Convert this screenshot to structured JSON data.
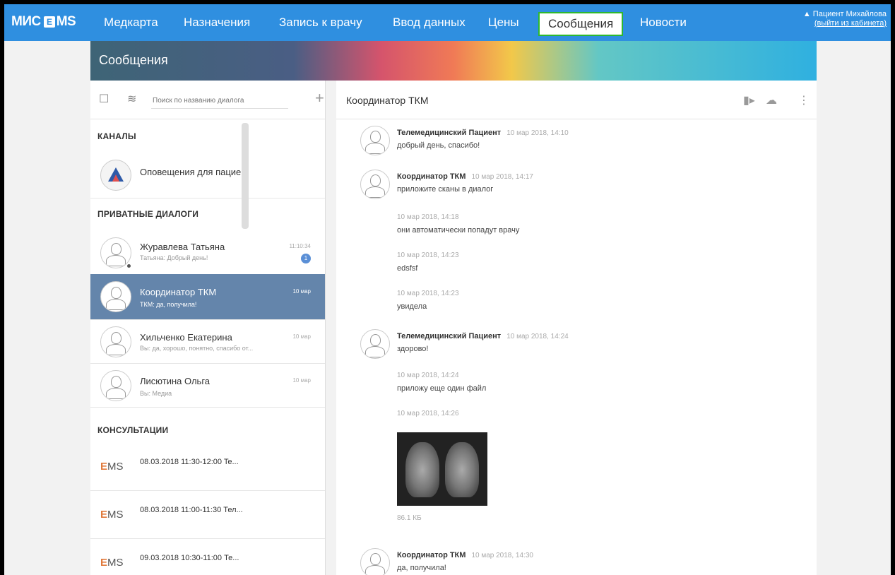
{
  "nav": {
    "logo_text": "МИС",
    "logo_badge": "E",
    "logo_suffix": "MS",
    "items": [
      {
        "label": "Медкарта"
      },
      {
        "label": "Назначения"
      },
      {
        "label": "Запись к врачу"
      },
      {
        "label": "Ввод данных"
      },
      {
        "label": "Цены"
      },
      {
        "label": "Сообщения"
      },
      {
        "label": "Новости"
      }
    ],
    "user_name": "Пациент Михайлова",
    "logout": "(выйти из кабинета)"
  },
  "banner": {
    "title": "Сообщения"
  },
  "left": {
    "search_placeholder": "Поиск по названию диалога",
    "sections": {
      "channels": "КАНАЛЫ",
      "private": "ПРИВАТНЫЕ ДИАЛОГИ",
      "consultations": "КОНСУЛЬТАЦИИ"
    },
    "channels": [
      {
        "name": "Оповещения для пацие..."
      }
    ],
    "private": [
      {
        "name": "Журавлева Татьяна",
        "sub": "Татьяна: Добрый день!",
        "date": "11:10:34",
        "badge": "1"
      },
      {
        "name": "Координатор ТКМ",
        "sub": "ТКМ: да, получила!",
        "date": "10 мар"
      },
      {
        "name": "Хильченко Екатерина",
        "sub": "Вы: да, хорошо, понятно, спасибо от...",
        "date": "10 мар"
      },
      {
        "name": "Лисютина Ольга",
        "sub": "Вы: Медиа",
        "date": "10 мар"
      }
    ],
    "consultations": [
      {
        "name": "08.03.2018 11:30-12:00 Te..."
      },
      {
        "name": "08.03.2018 11:00-11:30 Тел..."
      },
      {
        "name": "09.03.2018 10:30-11:00 Те..."
      }
    ]
  },
  "right": {
    "title": "Координатор ТКМ",
    "messages": [
      {
        "author": "Телемедицинский Пациент",
        "time": "10 мар 2018, 14:10",
        "text": "добрый день, спасибо!"
      },
      {
        "author": "Координатор ТКМ",
        "time": "10 мар 2018, 14:17",
        "text": "приложите сканы в диалог"
      },
      {
        "time": "10 мар 2018, 14:18",
        "text": "они автоматически попадут врачу"
      },
      {
        "time": "10 мар 2018, 14:23",
        "text": "edsfsf"
      },
      {
        "time": "10 мар 2018, 14:23",
        "text": "увидела"
      },
      {
        "author": "Телемедицинский Пациент",
        "time": "10 мар 2018, 14:24",
        "text": "здорово!"
      },
      {
        "time": "10 мар 2018, 14:24",
        "text": "приложу еще один файл"
      },
      {
        "time": "10 мар 2018, 14:26",
        "file_size": "86.1 КБ"
      },
      {
        "author": "Координатор ТКМ",
        "time": "10 мар 2018, 14:30",
        "text": "да, получила!"
      }
    ]
  },
  "colors": {
    "nav_bg": "#2f8fe0",
    "selected_row": "#6485ab",
    "active_border": "#2eb82e"
  }
}
